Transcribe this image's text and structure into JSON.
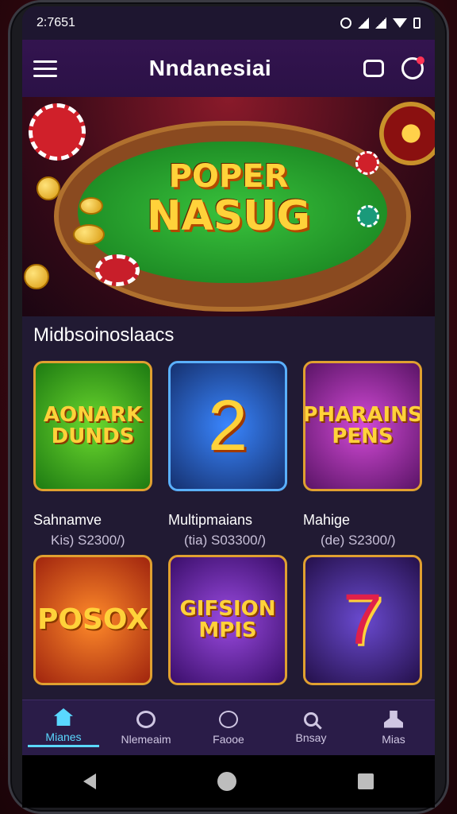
{
  "status_bar": {
    "time": "2:7651"
  },
  "header": {
    "title": "Nndanesiai"
  },
  "hero": {
    "line1": "POPER",
    "line2": "NASUG"
  },
  "section": {
    "title": "Midbsoinoslaacs"
  },
  "games": [
    {
      "art": "AONARK DUNDS",
      "name": "Sahnamve",
      "sub": "Kis) S2300/)"
    },
    {
      "art": "2",
      "name": "Multipmaians",
      "sub": "(tia) S03300/)"
    },
    {
      "art": "PHARAINS PENS",
      "name": "Mahige",
      "sub": "(de) S2300/)"
    },
    {
      "art": "POSOX",
      "name": "",
      "sub": ""
    },
    {
      "art": "GIFSION MPIS",
      "name": "",
      "sub": ""
    },
    {
      "art": "7",
      "name": "",
      "sub": ""
    }
  ],
  "nav": [
    {
      "label": "Mianes",
      "icon": "home-icon",
      "active": true
    },
    {
      "label": "Nlemeaim",
      "icon": "games-icon",
      "active": false
    },
    {
      "label": "Faooe",
      "icon": "favorites-icon",
      "active": false
    },
    {
      "label": "Bnsay",
      "icon": "search-icon",
      "active": false
    },
    {
      "label": "Mias",
      "icon": "user-icon",
      "active": false
    }
  ],
  "colors": {
    "accent": "#5ad8ff",
    "background": "#211a33",
    "header": "#2b1146"
  }
}
